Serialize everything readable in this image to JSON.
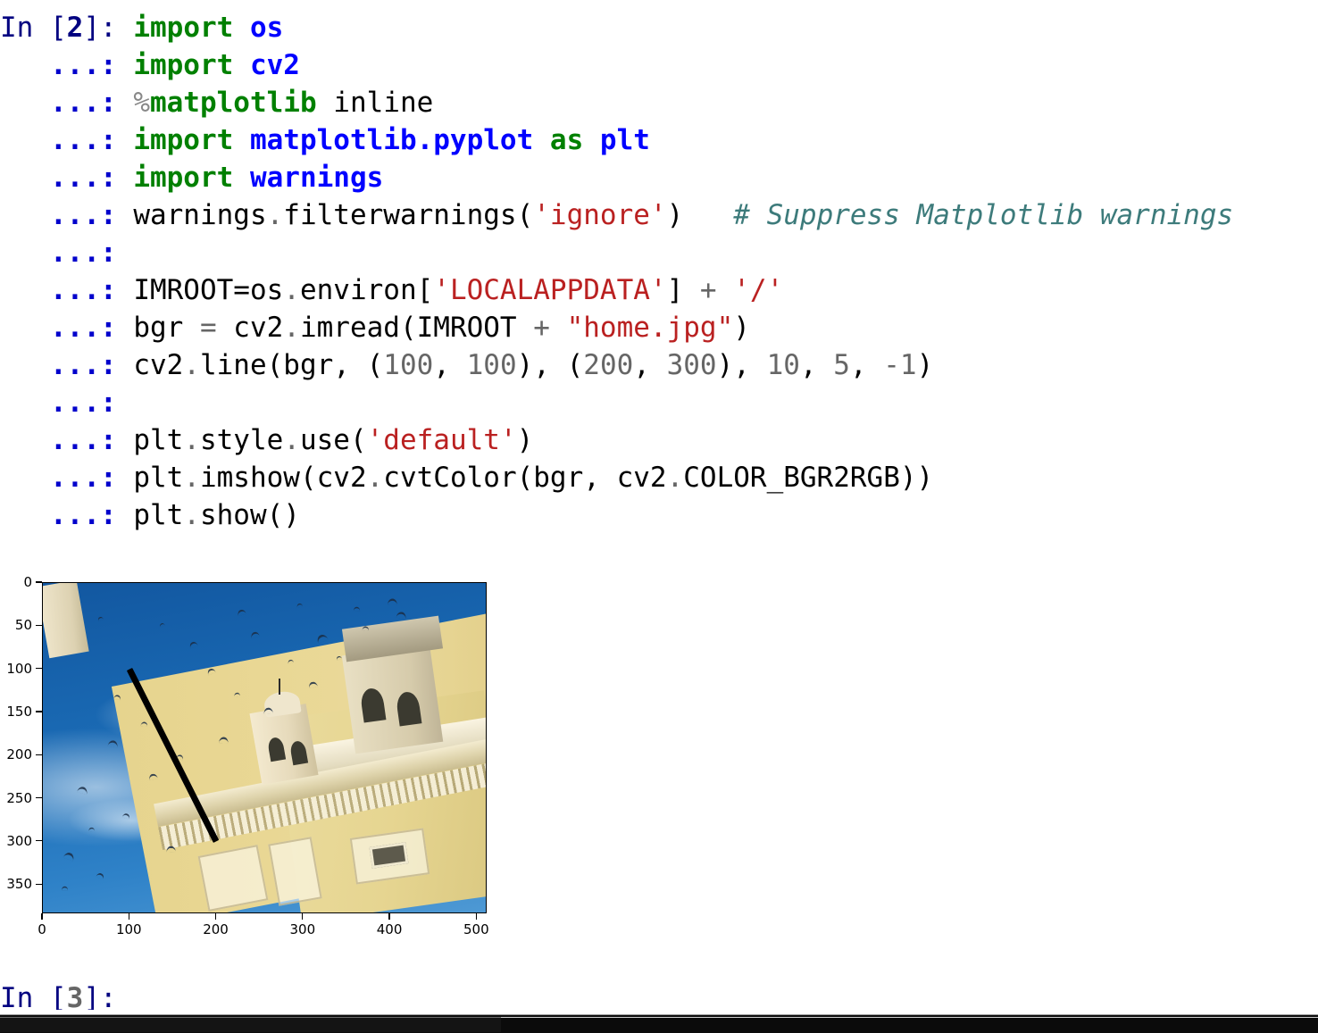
{
  "app": {
    "type": "ipython-console",
    "background": "#ffffff"
  },
  "colors": {
    "prompt": "#000080",
    "continuation": "#0000cc",
    "keyword": "#008000",
    "module": "#0000ff",
    "string": "#ba2121",
    "number": "#666666",
    "comment": "#3d7b7b",
    "operator": "#666666",
    "plain": "#000000",
    "line_drawn": "#000000"
  },
  "cell": {
    "prompt_label": "In [",
    "prompt_number": "2",
    "prompt_close": "]:",
    "continuation_prompt": "...:",
    "lines": [
      {
        "prompt": "In [2]:",
        "tokens": [
          {
            "t": "import",
            "c": "kw"
          },
          {
            "t": " ",
            "c": "plain"
          },
          {
            "t": "os",
            "c": "mod"
          }
        ]
      },
      {
        "prompt": "...:",
        "tokens": [
          {
            "t": "import",
            "c": "kw"
          },
          {
            "t": " ",
            "c": "plain"
          },
          {
            "t": "cv2",
            "c": "mod"
          }
        ]
      },
      {
        "prompt": "...:",
        "tokens": [
          {
            "t": "%",
            "c": "magic-pct"
          },
          {
            "t": "matplotlib",
            "c": "magic"
          },
          {
            "t": " inline",
            "c": "plain"
          }
        ]
      },
      {
        "prompt": "...:",
        "tokens": [
          {
            "t": "import",
            "c": "kw"
          },
          {
            "t": " ",
            "c": "plain"
          },
          {
            "t": "matplotlib.pyplot",
            "c": "mod"
          },
          {
            "t": " ",
            "c": "plain"
          },
          {
            "t": "as",
            "c": "kw"
          },
          {
            "t": " ",
            "c": "plain"
          },
          {
            "t": "plt",
            "c": "mod"
          }
        ]
      },
      {
        "prompt": "...:",
        "tokens": [
          {
            "t": "import",
            "c": "kw"
          },
          {
            "t": " ",
            "c": "plain"
          },
          {
            "t": "warnings",
            "c": "mod"
          }
        ]
      },
      {
        "prompt": "...:",
        "tokens": [
          {
            "t": "warnings",
            "c": "plain"
          },
          {
            "t": ".",
            "c": "dot"
          },
          {
            "t": "filterwarnings(",
            "c": "plain"
          },
          {
            "t": "'ignore'",
            "c": "str"
          },
          {
            "t": ")",
            "c": "plain"
          },
          {
            "t": "   ",
            "c": "plain"
          },
          {
            "t": "# Suppress Matplotlib warnings",
            "c": "comment"
          }
        ]
      },
      {
        "prompt": "...:",
        "tokens": []
      },
      {
        "prompt": "...:",
        "tokens": [
          {
            "t": "IMROOT=os",
            "c": "plain"
          },
          {
            "t": ".",
            "c": "dot"
          },
          {
            "t": "environ[",
            "c": "plain"
          },
          {
            "t": "'LOCALAPPDATA'",
            "c": "str"
          },
          {
            "t": "]",
            "c": "plain"
          },
          {
            "t": " + ",
            "c": "op"
          },
          {
            "t": "'/'",
            "c": "str"
          }
        ]
      },
      {
        "prompt": "...:",
        "tokens": [
          {
            "t": "bgr ",
            "c": "plain"
          },
          {
            "t": "= ",
            "c": "op"
          },
          {
            "t": "cv2",
            "c": "plain"
          },
          {
            "t": ".",
            "c": "dot"
          },
          {
            "t": "imread(IMROOT ",
            "c": "plain"
          },
          {
            "t": "+ ",
            "c": "op"
          },
          {
            "t": "\"home.jpg\"",
            "c": "str"
          },
          {
            "t": ")",
            "c": "plain"
          }
        ]
      },
      {
        "prompt": "...:",
        "tokens": [
          {
            "t": "cv2",
            "c": "plain"
          },
          {
            "t": ".",
            "c": "dot"
          },
          {
            "t": "line(bgr, (",
            "c": "plain"
          },
          {
            "t": "100",
            "c": "num"
          },
          {
            "t": ", ",
            "c": "plain"
          },
          {
            "t": "100",
            "c": "num"
          },
          {
            "t": "), (",
            "c": "plain"
          },
          {
            "t": "200",
            "c": "num"
          },
          {
            "t": ", ",
            "c": "plain"
          },
          {
            "t": "300",
            "c": "num"
          },
          {
            "t": "), ",
            "c": "plain"
          },
          {
            "t": "10",
            "c": "num"
          },
          {
            "t": ", ",
            "c": "plain"
          },
          {
            "t": "5",
            "c": "num"
          },
          {
            "t": ", ",
            "c": "plain"
          },
          {
            "t": "-1",
            "c": "num"
          },
          {
            "t": ")",
            "c": "plain"
          }
        ]
      },
      {
        "prompt": "...:",
        "tokens": []
      },
      {
        "prompt": "...:",
        "tokens": [
          {
            "t": "plt",
            "c": "plain"
          },
          {
            "t": ".",
            "c": "dot"
          },
          {
            "t": "style",
            "c": "plain"
          },
          {
            "t": ".",
            "c": "dot"
          },
          {
            "t": "use(",
            "c": "plain"
          },
          {
            "t": "'default'",
            "c": "str"
          },
          {
            "t": ")",
            "c": "plain"
          }
        ]
      },
      {
        "prompt": "...:",
        "tokens": [
          {
            "t": "plt",
            "c": "plain"
          },
          {
            "t": ".",
            "c": "dot"
          },
          {
            "t": "imshow(cv2",
            "c": "plain"
          },
          {
            "t": ".",
            "c": "dot"
          },
          {
            "t": "cvtColor(bgr, cv2",
            "c": "plain"
          },
          {
            "t": ".",
            "c": "dot"
          },
          {
            "t": "COLOR_BGR2RGB))",
            "c": "plain"
          }
        ]
      },
      {
        "prompt": "...:",
        "tokens": [
          {
            "t": "plt",
            "c": "plain"
          },
          {
            "t": ".",
            "c": "dot"
          },
          {
            "t": "show()",
            "c": "plain"
          }
        ]
      }
    ]
  },
  "chart_data": {
    "type": "image",
    "title": "",
    "xlabel": "",
    "ylabel": "",
    "xticks": [
      0,
      100,
      200,
      300,
      400,
      500
    ],
    "xticklabels": [
      "0",
      "100",
      "200",
      "300",
      "400",
      "500"
    ],
    "yticks": [
      0,
      50,
      100,
      150,
      200,
      250,
      300,
      350
    ],
    "yticklabels": [
      "0",
      "50",
      "100",
      "150",
      "200",
      "250",
      "300",
      "350"
    ],
    "xlim": [
      0,
      512
    ],
    "ylim": [
      384,
      0
    ],
    "grid": false,
    "legend": null,
    "image_description": "Photograph of a yellow ochre palace facade with white carved ornament and domed towers against a deep blue sky with flying birds",
    "annotations": [
      {
        "kind": "line",
        "from": [
          100,
          100
        ],
        "to": [
          200,
          300
        ],
        "color": "#000000",
        "thickness": 10,
        "source_call": "cv2.line(bgr, (100, 100), (200, 300), 10, 5, -1)"
      }
    ]
  },
  "next_cell": {
    "prompt_label": "In [",
    "prompt_number": "3",
    "prompt_close": "]:",
    "text": "In [3]:"
  },
  "scrollbar": {
    "orientation": "horizontal",
    "thumb_fraction": 0.38
  }
}
